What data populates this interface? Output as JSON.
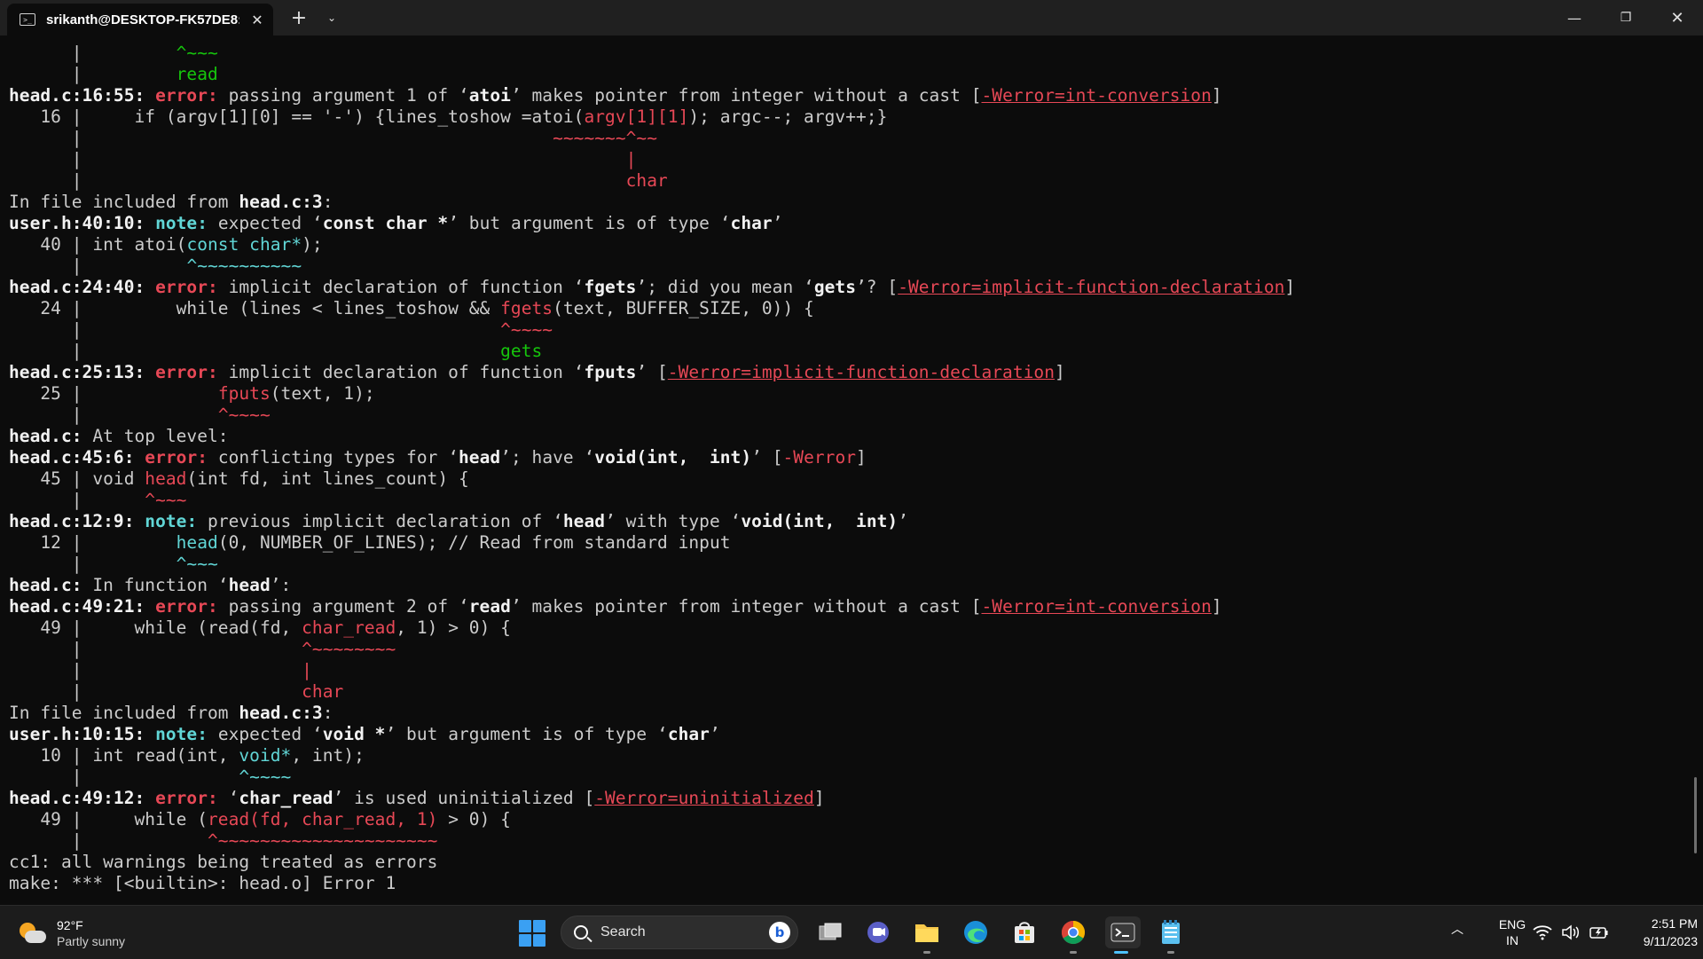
{
  "window": {
    "tab_title": "srikanth@DESKTOP-FK57DE8:",
    "tab_close": "✕",
    "new_tab": "+",
    "tab_dropdown": "⌄",
    "minimize": "—",
    "maximize": "❐",
    "close": "✕"
  },
  "terminal": {
    "lines": [
      [
        {
          "t": "      |         "
        },
        {
          "t": "^~~~",
          "s": "g"
        }
      ],
      [
        {
          "t": "      |         "
        },
        {
          "t": "read",
          "s": "g"
        }
      ],
      [
        {
          "t": "head.c:16:55: ",
          "s": "b"
        },
        {
          "t": "error: ",
          "s": "err"
        },
        {
          "t": "passing argument 1 of ‘"
        },
        {
          "t": "atoi",
          "s": "b"
        },
        {
          "t": "’ makes pointer from integer without a cast ["
        },
        {
          "t": "-Werror=int-conversion",
          "s": "r u"
        },
        {
          "t": "]"
        }
      ],
      [
        {
          "t": "   16 |     if (argv[1][0] == '-') {lines_toshow =atoi("
        },
        {
          "t": "argv[1][1]",
          "s": "r"
        },
        {
          "t": "); argc--; argv++;}"
        }
      ],
      [
        {
          "t": "      |                                             "
        },
        {
          "t": "~~~~~~~^~~",
          "s": "r"
        }
      ],
      [
        {
          "t": "      |                                                    "
        },
        {
          "t": "|",
          "s": "r"
        }
      ],
      [
        {
          "t": "      |                                                    "
        },
        {
          "t": "char",
          "s": "r"
        }
      ],
      [
        {
          "t": "In file included from "
        },
        {
          "t": "head.c:3",
          "s": "b"
        },
        {
          "t": ":"
        }
      ],
      [
        {
          "t": "user.h:40:10: ",
          "s": "b"
        },
        {
          "t": "note: ",
          "s": "note"
        },
        {
          "t": "expected ‘"
        },
        {
          "t": "const char *",
          "s": "b"
        },
        {
          "t": "’ but argument is of type ‘"
        },
        {
          "t": "char",
          "s": "b"
        },
        {
          "t": "’"
        }
      ],
      [
        {
          "t": "   40 | int atoi("
        },
        {
          "t": "const char*",
          "s": "c"
        },
        {
          "t": ");"
        }
      ],
      [
        {
          "t": "      |          "
        },
        {
          "t": "^~~~~~~~~~~",
          "s": "c"
        }
      ],
      [
        {
          "t": "head.c:24:40: ",
          "s": "b"
        },
        {
          "t": "error: ",
          "s": "err"
        },
        {
          "t": "implicit declaration of function ‘"
        },
        {
          "t": "fgets",
          "s": "b"
        },
        {
          "t": "’; did you mean ‘"
        },
        {
          "t": "gets",
          "s": "b"
        },
        {
          "t": "’? ["
        },
        {
          "t": "-Werror=implicit-function-declaration",
          "s": "r u"
        },
        {
          "t": "]"
        }
      ],
      [
        {
          "t": "   24 |         while (lines < lines_toshow && "
        },
        {
          "t": "fgets",
          "s": "r"
        },
        {
          "t": "(text, BUFFER_SIZE, 0)) {"
        }
      ],
      [
        {
          "t": "      |                                        "
        },
        {
          "t": "^~~~~",
          "s": "r"
        }
      ],
      [
        {
          "t": "      |                                        "
        },
        {
          "t": "gets",
          "s": "g"
        }
      ],
      [
        {
          "t": "head.c:25:13: ",
          "s": "b"
        },
        {
          "t": "error: ",
          "s": "err"
        },
        {
          "t": "implicit declaration of function ‘"
        },
        {
          "t": "fputs",
          "s": "b"
        },
        {
          "t": "’ ["
        },
        {
          "t": "-Werror=implicit-function-declaration",
          "s": "r u"
        },
        {
          "t": "]"
        }
      ],
      [
        {
          "t": "   25 |             "
        },
        {
          "t": "fputs",
          "s": "r"
        },
        {
          "t": "(text, 1);"
        }
      ],
      [
        {
          "t": "      |             "
        },
        {
          "t": "^~~~~",
          "s": "r"
        }
      ],
      [
        {
          "t": "head.c:",
          "s": "b"
        },
        {
          "t": " At top level:"
        }
      ],
      [
        {
          "t": "head.c:45:6: ",
          "s": "b"
        },
        {
          "t": "error: ",
          "s": "err"
        },
        {
          "t": "conflicting types for ‘"
        },
        {
          "t": "head",
          "s": "b"
        },
        {
          "t": "’; have ‘"
        },
        {
          "t": "void(int,  int)",
          "s": "b"
        },
        {
          "t": "’ ["
        },
        {
          "t": "-Werror",
          "s": "r"
        },
        {
          "t": "]"
        }
      ],
      [
        {
          "t": "   45 | void "
        },
        {
          "t": "head",
          "s": "r"
        },
        {
          "t": "(int fd, int lines_count) {"
        }
      ],
      [
        {
          "t": "      |      "
        },
        {
          "t": "^~~~",
          "s": "r"
        }
      ],
      [
        {
          "t": "head.c:12:9: ",
          "s": "b"
        },
        {
          "t": "note: ",
          "s": "note"
        },
        {
          "t": "previous implicit declaration of ‘"
        },
        {
          "t": "head",
          "s": "b"
        },
        {
          "t": "’ with type ‘"
        },
        {
          "t": "void(int,  int)",
          "s": "b"
        },
        {
          "t": "’"
        }
      ],
      [
        {
          "t": "   12 |         "
        },
        {
          "t": "head",
          "s": "c"
        },
        {
          "t": "(0, NUMBER_OF_LINES); // Read from standard input"
        }
      ],
      [
        {
          "t": "      |         "
        },
        {
          "t": "^~~~",
          "s": "c"
        }
      ],
      [
        {
          "t": "head.c:",
          "s": "b"
        },
        {
          "t": " In function ‘"
        },
        {
          "t": "head",
          "s": "b"
        },
        {
          "t": "’:"
        }
      ],
      [
        {
          "t": "head.c:49:21: ",
          "s": "b"
        },
        {
          "t": "error: ",
          "s": "err"
        },
        {
          "t": "passing argument 2 of ‘"
        },
        {
          "t": "read",
          "s": "b"
        },
        {
          "t": "’ makes pointer from integer without a cast ["
        },
        {
          "t": "-Werror=int-conversion",
          "s": "r u"
        },
        {
          "t": "]"
        }
      ],
      [
        {
          "t": "   49 |     while (read(fd, "
        },
        {
          "t": "char_read",
          "s": "r"
        },
        {
          "t": ", 1) > 0) {"
        }
      ],
      [
        {
          "t": "      |                     "
        },
        {
          "t": "^~~~~~~~~",
          "s": "r"
        }
      ],
      [
        {
          "t": "      |                     "
        },
        {
          "t": "|",
          "s": "r"
        }
      ],
      [
        {
          "t": "      |                     "
        },
        {
          "t": "char",
          "s": "r"
        }
      ],
      [
        {
          "t": "In file included from "
        },
        {
          "t": "head.c:3",
          "s": "b"
        },
        {
          "t": ":"
        }
      ],
      [
        {
          "t": "user.h:10:15: ",
          "s": "b"
        },
        {
          "t": "note: ",
          "s": "note"
        },
        {
          "t": "expected ‘"
        },
        {
          "t": "void *",
          "s": "b"
        },
        {
          "t": "’ but argument is of type ‘"
        },
        {
          "t": "char",
          "s": "b"
        },
        {
          "t": "’"
        }
      ],
      [
        {
          "t": "   10 | int read(int, "
        },
        {
          "t": "void*",
          "s": "c"
        },
        {
          "t": ", int);"
        }
      ],
      [
        {
          "t": "      |               "
        },
        {
          "t": "^~~~~",
          "s": "c"
        }
      ],
      [
        {
          "t": "head.c:49:12: ",
          "s": "b"
        },
        {
          "t": "error: ",
          "s": "err"
        },
        {
          "t": "‘"
        },
        {
          "t": "char_read",
          "s": "b"
        },
        {
          "t": "’ is used uninitialized ["
        },
        {
          "t": "-Werror=uninitialized",
          "s": "r u"
        },
        {
          "t": "]"
        }
      ],
      [
        {
          "t": "   49 |     while ("
        },
        {
          "t": "read(fd, char_read, 1)",
          "s": "r"
        },
        {
          "t": " > 0) {"
        }
      ],
      [
        {
          "t": "      |            "
        },
        {
          "t": "^~~~~~~~~~~~~~~~~~~~~~",
          "s": "r"
        }
      ],
      [
        {
          "t": "cc1: all warnings being treated as errors"
        }
      ],
      [
        {
          "t": "make: *** [<builtin>: head.o] Error 1"
        }
      ]
    ]
  },
  "taskbar": {
    "weather": {
      "temp": "92°F",
      "condition": "Partly sunny"
    },
    "search_label": "Search",
    "bing_label": "b",
    "lang_line1": "ENG",
    "lang_line2": "IN",
    "time": "2:51 PM",
    "date": "9/11/2023"
  }
}
